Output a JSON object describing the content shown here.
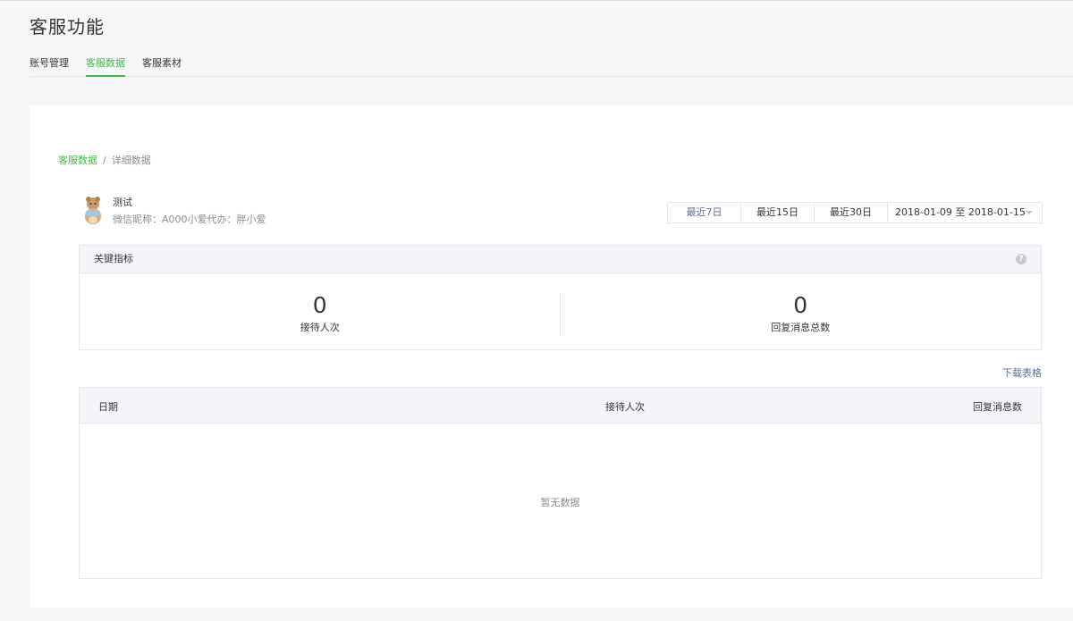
{
  "page": {
    "title": "客服功能"
  },
  "tabs": [
    {
      "label": "账号管理"
    },
    {
      "label": "客服数据",
      "active": true
    },
    {
      "label": "客服素材"
    }
  ],
  "breadcrumb": {
    "parent": "客服数据",
    "separator": "/",
    "current": "详细数据"
  },
  "user": {
    "name": "测试",
    "meta": "微信昵称：A000小爱代办：胖小爱"
  },
  "range": {
    "options": [
      "最近7日",
      "最近15日",
      "最近30日"
    ],
    "active_index": 0,
    "date_range": "2018-01-09 至 2018-01-15"
  },
  "kpi": {
    "title": "关键指标",
    "help_icon": "help-icon",
    "items": [
      {
        "value": "0",
        "label": "接待人次"
      },
      {
        "value": "0",
        "label": "回复消息总数"
      }
    ]
  },
  "download_label": "下载表格",
  "table": {
    "columns": [
      "日期",
      "接待人次",
      "回复消息数"
    ],
    "empty_text": "暂无数据"
  },
  "colors": {
    "accent": "#44b549",
    "link": "#5a6f98"
  }
}
